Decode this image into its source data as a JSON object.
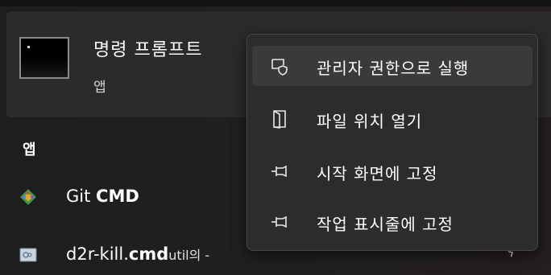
{
  "best_match": {
    "app_name": "명령 프롬프트",
    "app_type": "앱",
    "icon": "command-prompt-icon"
  },
  "section": {
    "title": "앱"
  },
  "results": [
    {
      "icon": "git-icon",
      "name_plain": "Git ",
      "name_bold": "CMD",
      "name_suffix": "",
      "extra": ""
    },
    {
      "icon": "file-icon",
      "name_plain": "d2r-kill.",
      "name_bold": "cmd",
      "name_suffix": "util의",
      "extra": " -",
      "chevron": "›"
    }
  ],
  "context_menu": {
    "items": [
      {
        "label": "관리자 권한으로 실행",
        "icon": "shield-icon"
      },
      {
        "label": "파일 위치 열기",
        "icon": "folder-open-icon"
      },
      {
        "label": "시작 화면에 고정",
        "icon": "pin-icon"
      },
      {
        "label": "작업 표시줄에 고정",
        "icon": "pin-icon"
      }
    ]
  }
}
